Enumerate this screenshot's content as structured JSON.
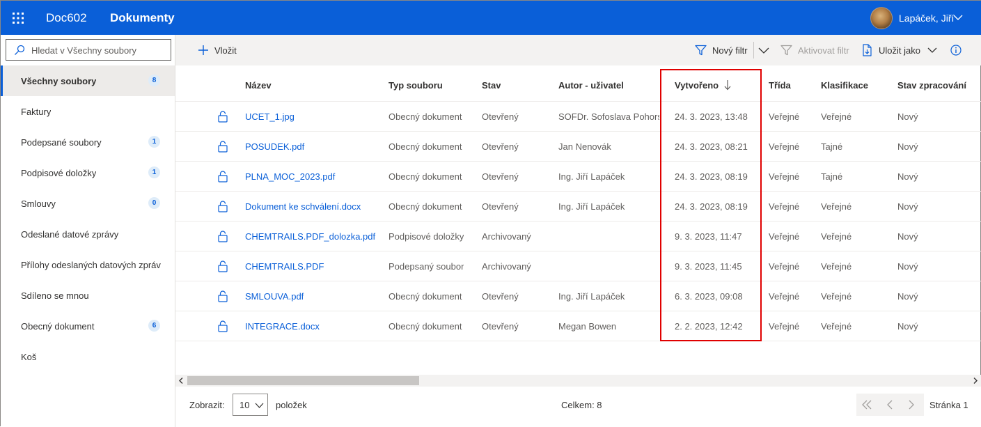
{
  "header": {
    "app_name": "Doc602",
    "page_title": "Dokumenty",
    "user_name": "Lapáček, Jiří"
  },
  "sidebar": {
    "search_placeholder": "Hledat v Všechny soubory",
    "items": [
      {
        "label": "Všechny soubory",
        "badge": "8",
        "active": true
      },
      {
        "label": "Faktury",
        "badge": ""
      },
      {
        "label": "Podepsané soubory",
        "badge": "1"
      },
      {
        "label": "Podpisové doložky",
        "badge": "1"
      },
      {
        "label": "Smlouvy",
        "badge": "0"
      },
      {
        "label": "Odeslané datové zprávy",
        "badge": ""
      },
      {
        "label": "Přílohy odeslaných datových zpráv",
        "badge": ""
      },
      {
        "label": "Sdíleno se mnou",
        "badge": ""
      },
      {
        "label": "Obecný dokument",
        "badge": "6"
      },
      {
        "label": "Koš",
        "badge": ""
      }
    ]
  },
  "toolbar": {
    "insert_label": "Vložit",
    "new_filter_label": "Nový filtr",
    "activate_filter_label": "Aktivovat filtr",
    "save_as_label": "Uložit jako"
  },
  "table": {
    "columns": {
      "name": "Název",
      "type": "Typ souboru",
      "status": "Stav",
      "author": "Autor - uživatel",
      "created": "Vytvořeno",
      "class": "Třída",
      "classification": "Klasifikace",
      "processing": "Stav zpracování"
    },
    "rows": [
      {
        "name": "UCET_1.jpg",
        "type": "Obecný dokument",
        "status": "Otevřený",
        "author": "SOFDr. Sofoslava Pohorská",
        "created": "24. 3. 2023, 13:48",
        "class": "Veřejné",
        "classification": "Veřejné",
        "processing": "Nový"
      },
      {
        "name": "POSUDEK.pdf",
        "type": "Obecný dokument",
        "status": "Otevřený",
        "author": "Jan Nenovák",
        "created": "24. 3. 2023, 08:21",
        "class": "Veřejné",
        "classification": "Tajné",
        "processing": "Nový"
      },
      {
        "name": "PLNA_MOC_2023.pdf",
        "type": "Obecný dokument",
        "status": "Otevřený",
        "author": "Ing. Jiří Lapáček",
        "created": "24. 3. 2023, 08:19",
        "class": "Veřejné",
        "classification": "Tajné",
        "processing": "Nový"
      },
      {
        "name": "Dokument ke schválení.docx",
        "type": "Obecný dokument",
        "status": "Otevřený",
        "author": "Ing. Jiří Lapáček",
        "created": "24. 3. 2023, 08:19",
        "class": "Veřejné",
        "classification": "Veřejné",
        "processing": "Nový"
      },
      {
        "name": "CHEMTRAILS.PDF_dolozka.pdf",
        "type": "Podpisové doložky",
        "status": "Archivovaný",
        "author": "",
        "created": "9. 3. 2023, 11:47",
        "class": "Veřejné",
        "classification": "Veřejné",
        "processing": "Nový"
      },
      {
        "name": "CHEMTRAILS.PDF",
        "type": "Podepsaný soubor",
        "status": "Archivovaný",
        "author": "",
        "created": "9. 3. 2023, 11:45",
        "class": "Veřejné",
        "classification": "Veřejné",
        "processing": "Nový"
      },
      {
        "name": "SMLOUVA.pdf",
        "type": "Obecný dokument",
        "status": "Otevřený",
        "author": "Ing. Jiří Lapáček",
        "created": "6. 3. 2023, 09:08",
        "class": "Veřejné",
        "classification": "Veřejné",
        "processing": "Nový"
      },
      {
        "name": "INTEGRACE.docx",
        "type": "Obecný dokument",
        "status": "Otevřený",
        "author": "Megan Bowen",
        "created": "2. 2. 2023, 12:42",
        "class": "Veřejné",
        "classification": "Veřejné",
        "processing": "Nový"
      }
    ]
  },
  "footer": {
    "show_label": "Zobrazit:",
    "page_size": "10",
    "items_label": "položek",
    "total": "Celkem: 8",
    "page_label": "Stránka 1"
  },
  "colors": {
    "brand": "#0a5fd8",
    "highlight": "#e00000"
  }
}
